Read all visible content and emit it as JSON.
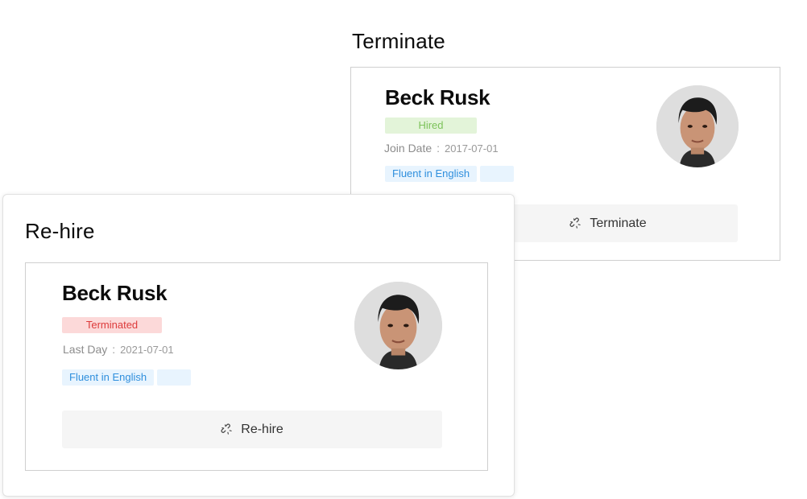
{
  "terminate_section": {
    "title": "Terminate",
    "card": {
      "name": "Beck Rusk",
      "status": "Hired",
      "date_label": "Join Date",
      "date_separator": ":",
      "date_value": "2017-07-01",
      "tags": [
        "Fluent in English",
        ""
      ],
      "button_label": "Terminate",
      "button_icon": "unlink-icon"
    }
  },
  "rehire_section": {
    "title": "Re-hire",
    "card": {
      "name": "Beck Rusk",
      "status": "Terminated",
      "date_label": "Last Day",
      "date_separator": ":",
      "date_value": "2021-07-01",
      "tags": [
        "Fluent in English",
        ""
      ],
      "button_label": "Re-hire",
      "button_icon": "unlink-icon"
    }
  },
  "colors": {
    "hired_bg": "#e3f4d9",
    "hired_text": "#7cc25a",
    "terminated_bg": "#fcd9d9",
    "terminated_text": "#dd3b3b",
    "tag_bg": "#e8f4fe",
    "tag_text": "#2f8fdd",
    "button_bg": "#f5f5f5"
  }
}
